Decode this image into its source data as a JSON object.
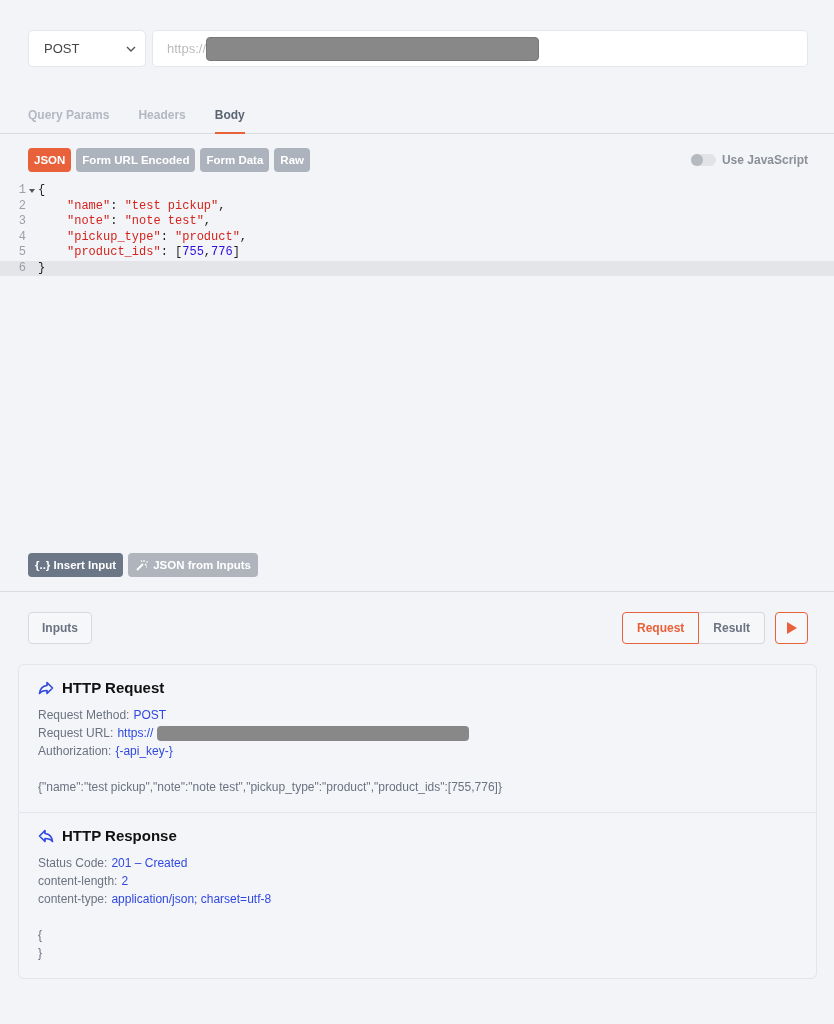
{
  "request_bar": {
    "method": "POST",
    "url": {
      "text": "https://",
      "redacted": true
    }
  },
  "tabs": [
    {
      "label": "Query Params",
      "selected": false
    },
    {
      "label": "Headers",
      "selected": false
    },
    {
      "label": "Body",
      "selected": true
    }
  ],
  "body_types": [
    {
      "label": "JSON",
      "selected": true
    },
    {
      "label": "Form URL Encoded",
      "selected": false
    },
    {
      "label": "Form Data",
      "selected": false
    },
    {
      "label": "Raw",
      "selected": false
    }
  ],
  "use_javascript": {
    "label": "Use JavaScript",
    "on": false
  },
  "editor": {
    "lines": [
      {
        "number": "1",
        "foldable": true,
        "active": false,
        "tokens": [
          {
            "kind": "punct",
            "text": "{"
          }
        ]
      },
      {
        "number": "2",
        "foldable": false,
        "active": false,
        "indented": true,
        "tokens": [
          {
            "kind": "string",
            "text": "\"name\""
          },
          {
            "kind": "punct",
            "text": ": "
          },
          {
            "kind": "string",
            "text": "\"test pickup\""
          },
          {
            "kind": "punct",
            "text": ","
          }
        ]
      },
      {
        "number": "3",
        "foldable": false,
        "active": false,
        "indented": true,
        "tokens": [
          {
            "kind": "string",
            "text": "\"note\""
          },
          {
            "kind": "punct",
            "text": ": "
          },
          {
            "kind": "string",
            "text": "\"note test\""
          },
          {
            "kind": "punct",
            "text": ","
          }
        ]
      },
      {
        "number": "4",
        "foldable": false,
        "active": false,
        "indented": true,
        "tokens": [
          {
            "kind": "string",
            "text": "\"pickup_type\""
          },
          {
            "kind": "punct",
            "text": ": "
          },
          {
            "kind": "string",
            "text": "\"product\""
          },
          {
            "kind": "punct",
            "text": ","
          }
        ]
      },
      {
        "number": "5",
        "foldable": false,
        "active": false,
        "indented": true,
        "tokens": [
          {
            "kind": "string",
            "text": "\"product_ids\""
          },
          {
            "kind": "punct",
            "text": ": ["
          },
          {
            "kind": "number",
            "text": "755"
          },
          {
            "kind": "punct",
            "text": ","
          },
          {
            "kind": "number",
            "text": "776"
          },
          {
            "kind": "punct",
            "text": "]"
          }
        ]
      },
      {
        "number": "6",
        "foldable": false,
        "active": true,
        "tokens": [
          {
            "kind": "punct",
            "text": "}"
          }
        ]
      }
    ]
  },
  "editor_actions": [
    {
      "label": "{..} Insert Input",
      "kind": "primary"
    },
    {
      "label": "JSON from Inputs",
      "kind": "wand"
    }
  ],
  "inputs_button": "Inputs",
  "view_tabs": [
    {
      "label": "Request",
      "selected": true
    },
    {
      "label": "Result",
      "selected": false
    }
  ],
  "http_request": {
    "title": "HTTP Request",
    "fields": [
      {
        "label": "Request Method:",
        "value": "POST"
      },
      {
        "label": "Request URL:",
        "value": "https://",
        "redacted": true
      },
      {
        "label": "Authorization:",
        "value": "{-api_key-}"
      }
    ],
    "body_lines": [
      "{\"name\":\"test pickup\",\"note\":\"note test\",\"pickup_type\":\"product\",\"product_ids\":[755,776]}"
    ]
  },
  "http_response": {
    "title": "HTTP Response",
    "fields": [
      {
        "label": "Status Code:",
        "value": "201 – Created"
      },
      {
        "label": "content-length:",
        "value": "2"
      },
      {
        "label": "content-type:",
        "value": "application/json; charset=utf-8"
      }
    ],
    "body_lines": [
      "{",
      "}"
    ]
  }
}
